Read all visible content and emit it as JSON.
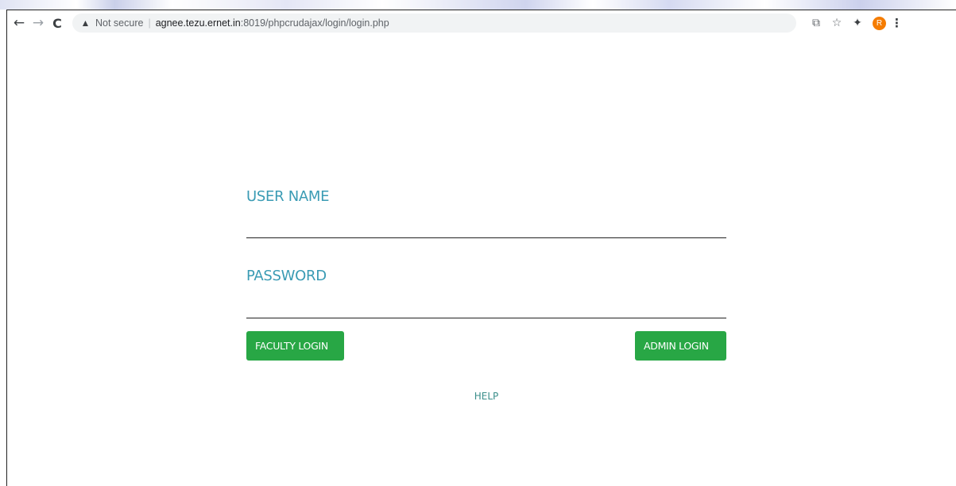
{
  "browser": {
    "back_icon": "←",
    "forward_icon": "→",
    "reload_icon": "C",
    "security_icon": "▲",
    "security_text": "Not secure",
    "separator": "|",
    "url_host": "agnee.tezu.ernet.in",
    "url_rest": ":8019/phpcrudajax/login/login.php",
    "share_icon": "⧉",
    "bookmark_icon": "☆",
    "extensions_icon": "✦",
    "profile_initial": "R",
    "menu_icon": "⋮"
  },
  "login": {
    "username_label": "USER NAME",
    "password_label": "PASSWORD",
    "faculty_button": "FACULTY LOGIN",
    "admin_button": "ADMIN LOGIN",
    "help_link": "HELP"
  },
  "colors": {
    "label": "#3a9bb4",
    "button": "#28a745",
    "help": "#3a8e8a",
    "avatar": "#f57c00"
  }
}
